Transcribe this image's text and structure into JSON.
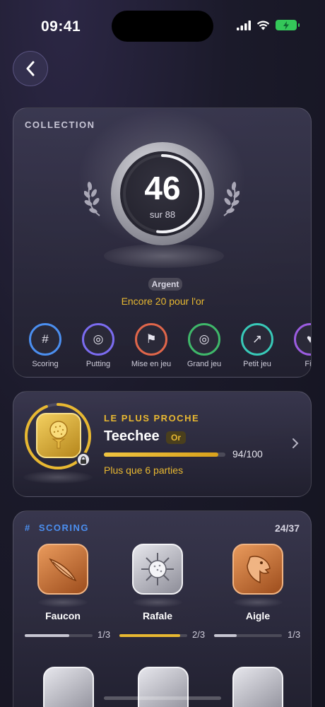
{
  "status": {
    "time": "09:41"
  },
  "collection": {
    "kicker": "COLLECTION",
    "count": "46",
    "total_label": "sur 88",
    "progress_fraction": 0.52,
    "tier": "Argent",
    "next_tier_text": "Encore 20 pour l'or",
    "categories": [
      {
        "label": "Scoring",
        "glyph": "#",
        "icon": "hash-icon",
        "color": "#4b8ff0"
      },
      {
        "label": "Putting",
        "glyph": "◎",
        "icon": "target-icon",
        "color": "#7b6cf0"
      },
      {
        "label": "Mise en jeu",
        "glyph": "⚑",
        "icon": "flag-icon",
        "color": "#e0664a"
      },
      {
        "label": "Grand jeu",
        "glyph": "◎",
        "icon": "bullseye-icon",
        "color": "#3fb86a"
      },
      {
        "label": "Petit jeu",
        "glyph": "↗",
        "icon": "arrow-icon",
        "color": "#38c9b8"
      },
      {
        "label": "Fid",
        "glyph": "♥",
        "icon": "heart-icon",
        "color": "#9b5ce0"
      }
    ]
  },
  "closest": {
    "kicker": "LE PLUS PROCHE",
    "name": "Teechee",
    "tier": "Or",
    "progress_text": "94/100",
    "progress_fraction": 0.94,
    "remaining_text": "Plus que 6 parties",
    "icon": "golf-tee-icon",
    "lock_icon": "lock-icon"
  },
  "scoring": {
    "title": "SCORING",
    "title_glyph": "#",
    "count": "24/37",
    "badges": [
      {
        "name": "Faucon",
        "frac": "1/3",
        "progress": 0.66,
        "tier": "bronze",
        "icon": "feather-icon",
        "bar_color": "#c7c6d2"
      },
      {
        "name": "Rafale",
        "frac": "2/3",
        "progress": 0.9,
        "tier": "silver",
        "icon": "sunburst-ball-icon",
        "bar_color": "#e8b831"
      },
      {
        "name": "Aigle",
        "frac": "1/3",
        "progress": 0.33,
        "tier": "bronze",
        "icon": "eagle-icon",
        "bar_color": "#c7c6d2"
      }
    ],
    "row2": [
      {
        "icon": "golf-ball-icon"
      },
      {
        "icon": "shield-icon"
      },
      {
        "icon": "crown-icon"
      }
    ]
  }
}
